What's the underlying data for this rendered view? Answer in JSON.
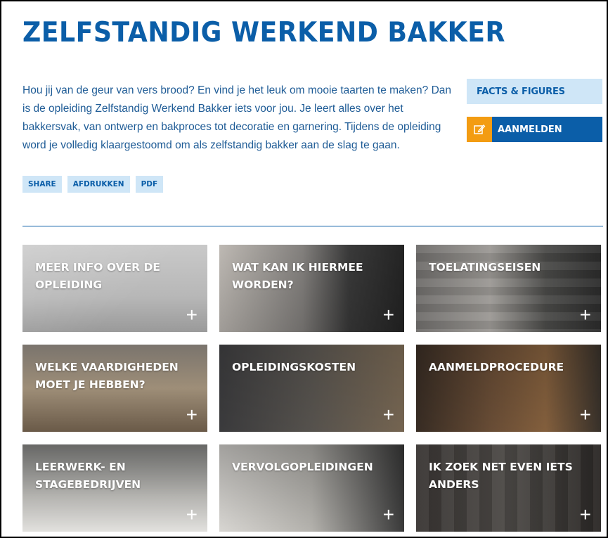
{
  "page": {
    "title": "ZELFSTANDIG WERKEND BAKKER",
    "intro": "Hou jij van de geur van vers brood? En vind je het leuk om mooie taarten te maken? Dan is de opleiding Zelfstandig Werkend Bakker iets voor jou. Je leert alles over het bakkersvak, van ontwerp en bakproces tot decoratie en garnering. Tijdens de opleiding word je volledig klaargestoomd om als zelfstandig bakker aan de slag te gaan."
  },
  "sidebar": {
    "facts_label": "FACTS & FIGURES",
    "register_label": "AANMELDEN",
    "register_icon": "edit-icon"
  },
  "actions": {
    "share": "SHARE",
    "print": "AFDRUKKEN",
    "pdf": "PDF"
  },
  "tiles": [
    {
      "label": "MEER INFO OVER DE OPLEIDING",
      "plus": "+"
    },
    {
      "label": "WAT KAN IK HIERMEE WORDEN?",
      "plus": "+"
    },
    {
      "label": "TOELATINGSEISEN",
      "plus": "+"
    },
    {
      "label": "WELKE VAARDIGHEDEN MOET JE HEBBEN?",
      "plus": "+"
    },
    {
      "label": "OPLEIDINGSKOSTEN",
      "plus": "+"
    },
    {
      "label": "AANMELDPROCEDURE",
      "plus": "+"
    },
    {
      "label": "LEERWERK- EN STAGEBEDRIJVEN",
      "plus": "+"
    },
    {
      "label": "VERVOLGOPLEIDINGEN",
      "plus": "+"
    },
    {
      "label": "IK ZOEK NET EVEN IETS ANDERS",
      "plus": "+"
    }
  ],
  "colors": {
    "primary": "#0b5ea8",
    "light": "#cfe6f7",
    "accent": "#f39c12"
  }
}
